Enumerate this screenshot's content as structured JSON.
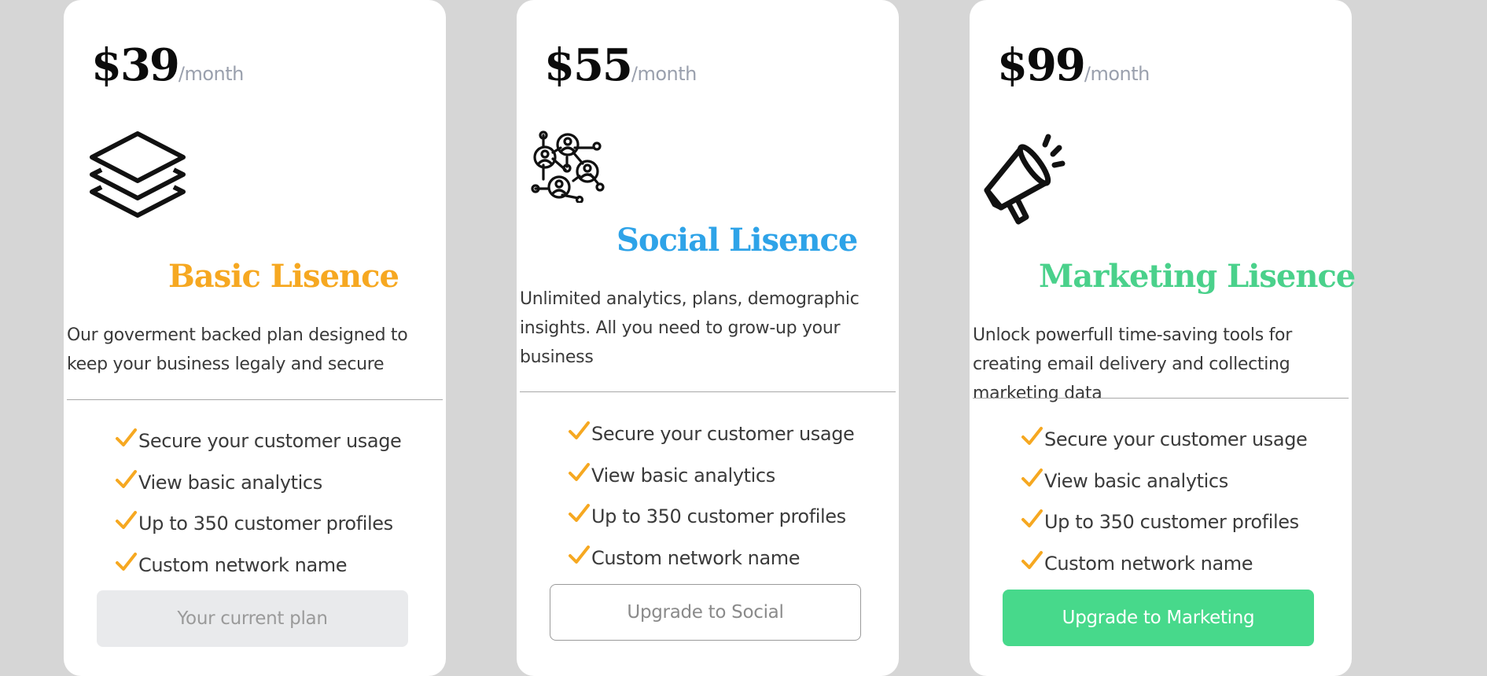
{
  "colors": {
    "background": "#d6d6d6",
    "card": "#ffffff",
    "basic_accent": "#f6a821",
    "social_accent": "#2ea3e8",
    "marketing_accent": "#47d98b",
    "check": "#f6a821",
    "muted_text": "#9aa0ad"
  },
  "plans": [
    {
      "price": "$39",
      "period": "/month",
      "icon": "stacked-layers-icon",
      "name": "Basic Lisence",
      "description": "Our goverment backed plan designed to keep your business legaly and secure",
      "features": [
        "Secure your customer usage",
        "View basic analytics",
        "Up to 350 customer profiles",
        "Custom network name"
      ],
      "button_label": "Your current plan"
    },
    {
      "price": "$55",
      "period": "/month",
      "icon": "social-network-icon",
      "name": "Social Lisence",
      "description": "Unlimited analytics, plans, demographic insights. All you need to grow-up your business",
      "features": [
        "Secure your customer usage",
        "View basic analytics",
        "Up to 350 customer profiles",
        "Custom network name"
      ],
      "button_label": "Upgrade to Social"
    },
    {
      "price": "$99",
      "period": "/month",
      "icon": "megaphone-icon",
      "name": "Marketing Lisence",
      "description": "Unlock powerfull time-saving tools for creating email delivery and collecting marketing data",
      "features": [
        "Secure your customer usage",
        "View basic analytics",
        "Up to 350 customer profiles",
        "Custom network name"
      ],
      "button_label": "Upgrade to Marketing"
    }
  ]
}
